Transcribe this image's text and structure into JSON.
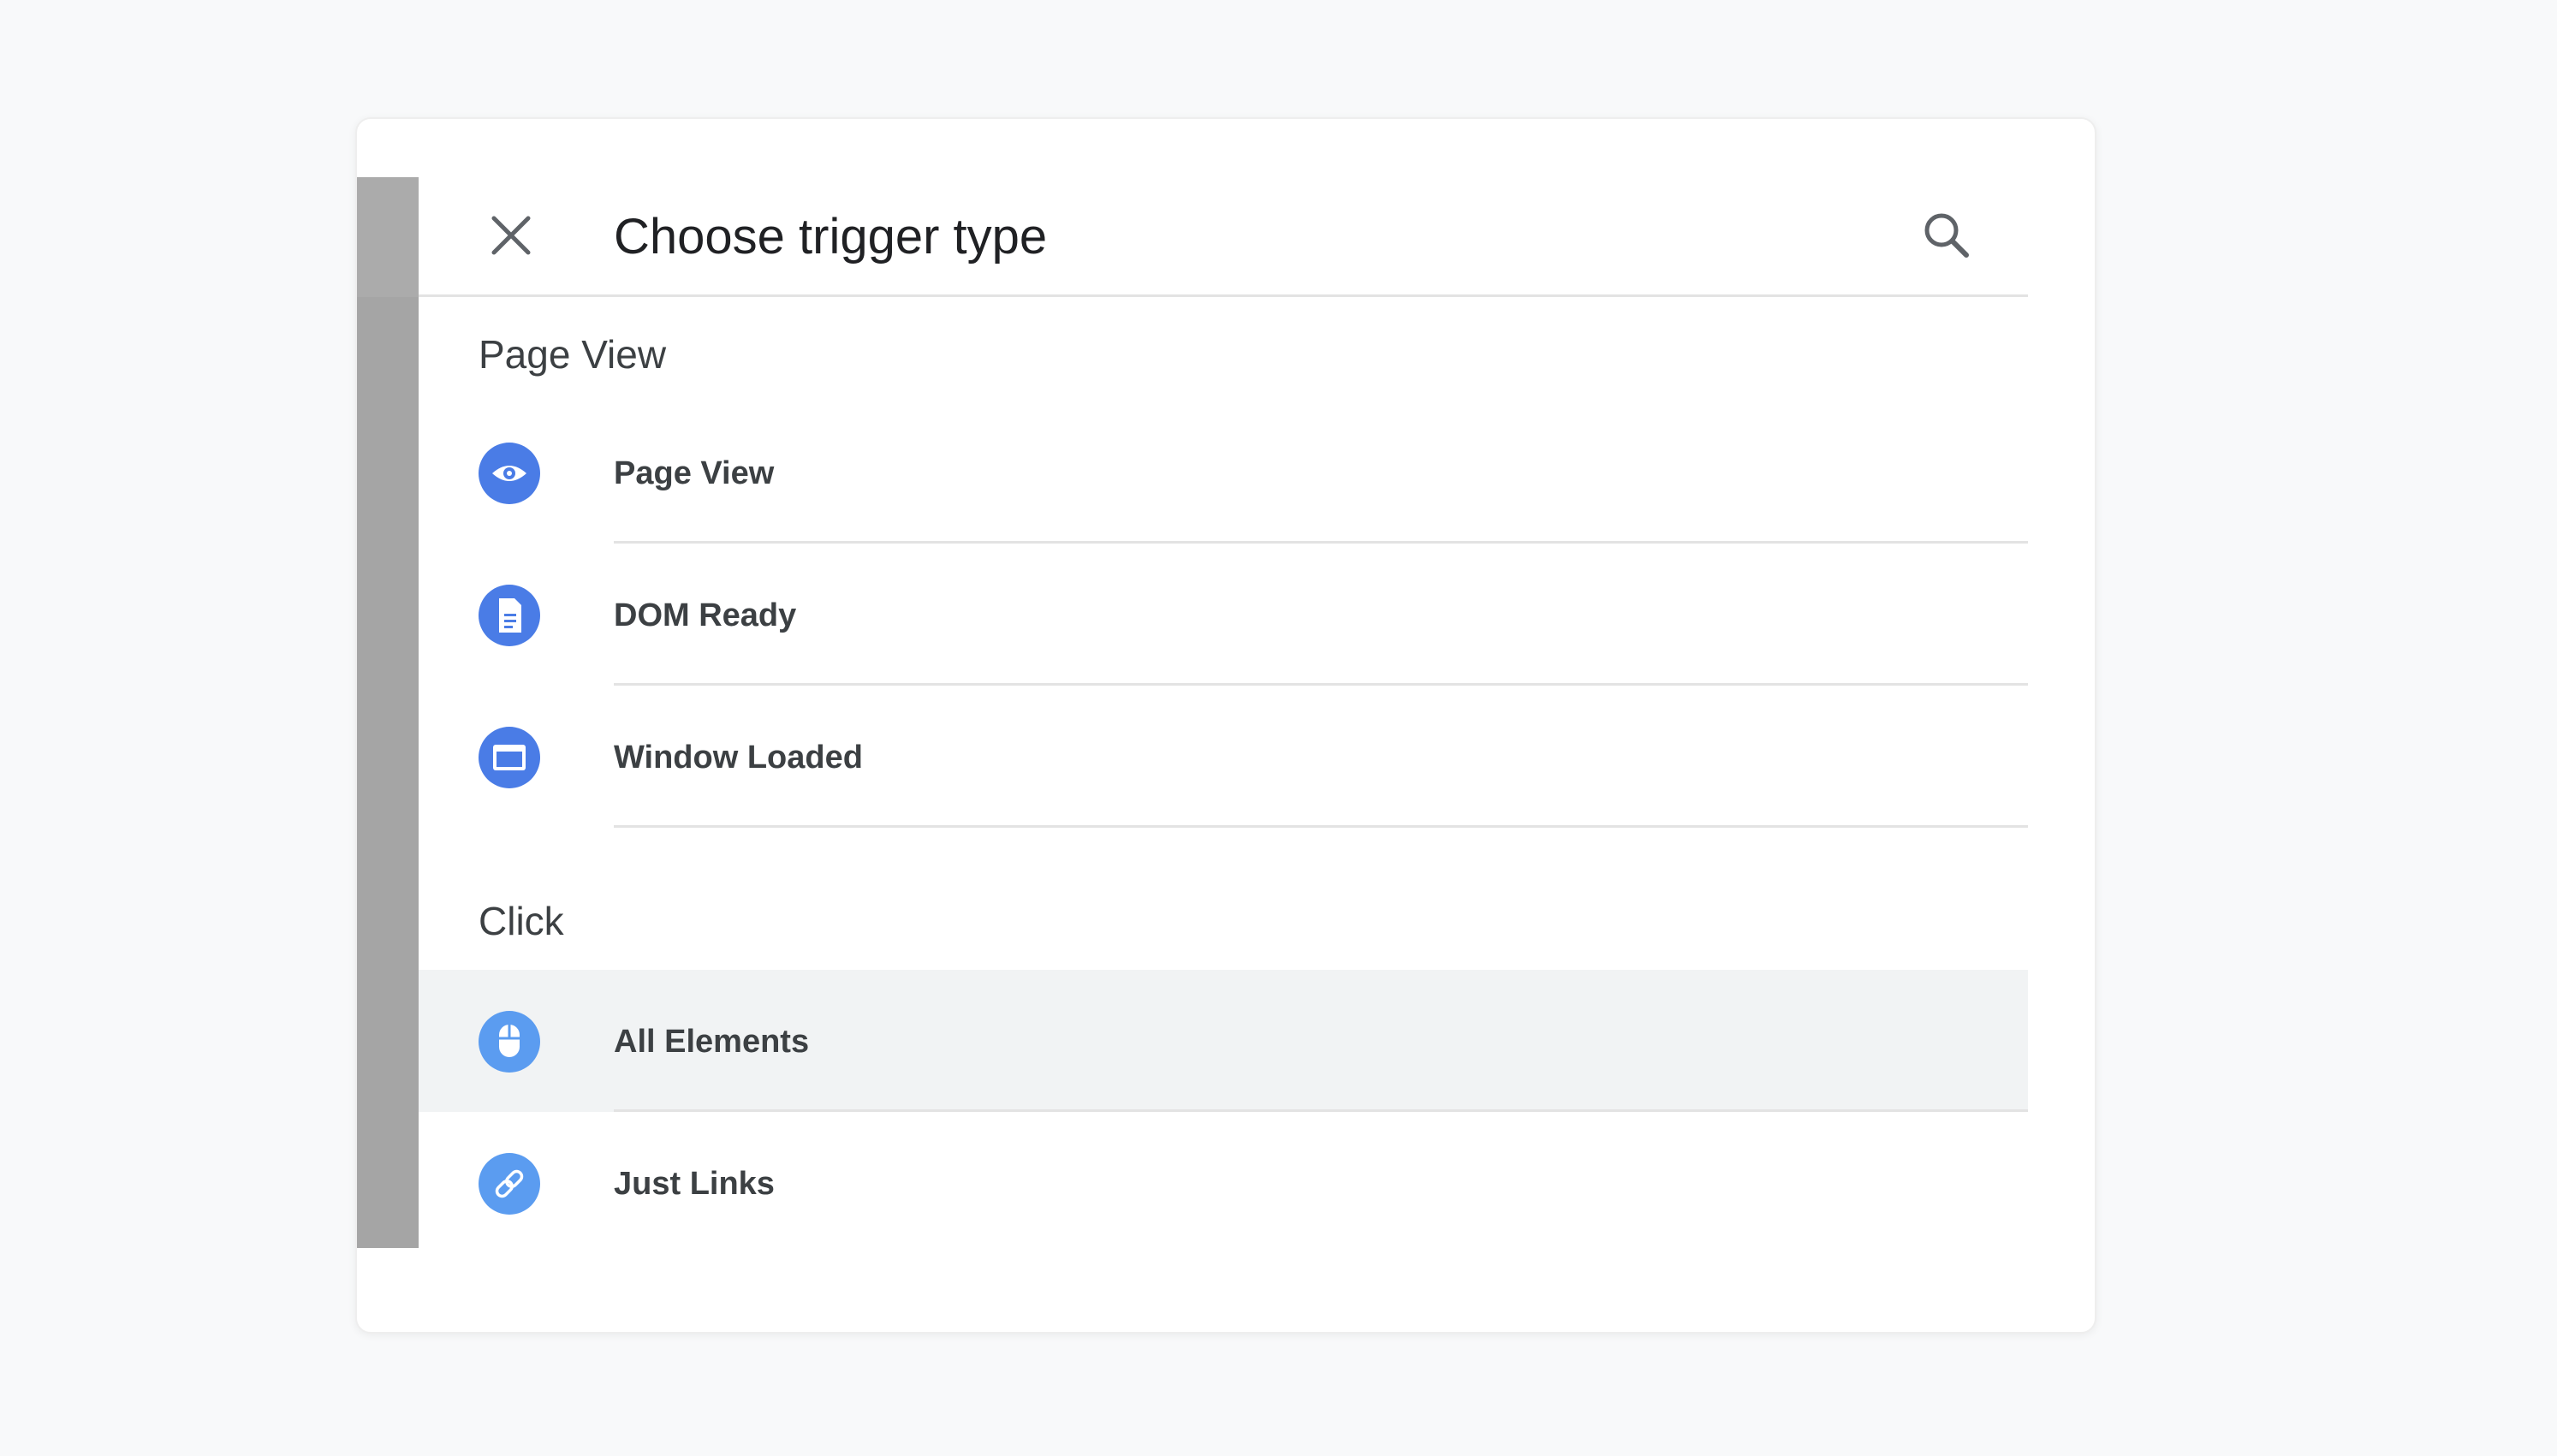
{
  "dialog": {
    "title": "Choose trigger type"
  },
  "colors": {
    "icon_primary": "#4a7ce6",
    "icon_light": "#5b9cf0",
    "selected_row": "#f1f3f4"
  },
  "sections": [
    {
      "title": "Page View",
      "items": [
        {
          "label": "Page View",
          "icon": "eye-icon"
        },
        {
          "label": "DOM Ready",
          "icon": "document-icon"
        },
        {
          "label": "Window Loaded",
          "icon": "window-icon"
        }
      ]
    },
    {
      "title": "Click",
      "items": [
        {
          "label": "All Elements",
          "icon": "mouse-icon",
          "selected": true
        },
        {
          "label": "Just Links",
          "icon": "link-icon"
        }
      ]
    }
  ]
}
